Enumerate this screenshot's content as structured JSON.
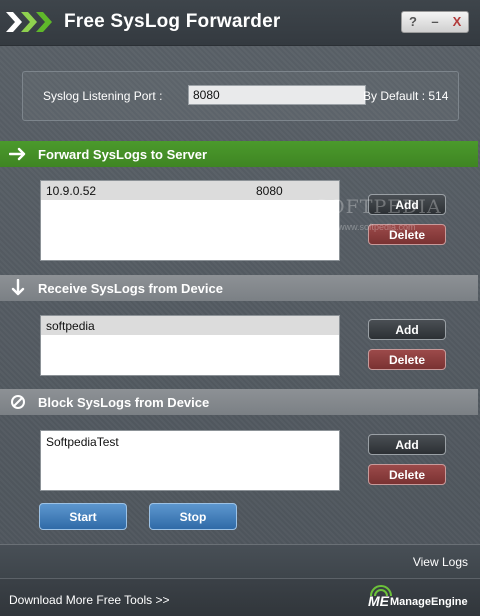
{
  "window": {
    "title": "Free SysLog Forwarder",
    "controls": {
      "help": "?",
      "minimize": "–",
      "close": "X"
    }
  },
  "port": {
    "label": "Syslog Listening Port  :",
    "value": "8080",
    "default_text": "By Default : 514"
  },
  "forward": {
    "title": "Forward SysLogs to Server",
    "rows": [
      {
        "host": "10.9.0.52",
        "port": "8080"
      }
    ],
    "add_label": "Add",
    "delete_label": "Delete"
  },
  "receive": {
    "title": "Receive SysLogs from Device",
    "rows": [
      {
        "host": "softpedia"
      }
    ],
    "add_label": "Add",
    "delete_label": "Delete"
  },
  "block": {
    "title": "Block SysLogs from Device",
    "rows": [
      {
        "host": "SoftpediaTest"
      }
    ],
    "add_label": "Add",
    "delete_label": "Delete"
  },
  "actions": {
    "start_label": "Start",
    "stop_label": "Stop"
  },
  "footer": {
    "view_logs": "View Logs",
    "download_link": "Download More Free Tools >>",
    "brand_mark": "ME",
    "brand_name": "ManageEngine"
  },
  "watermark": {
    "text": "SOFTPEDIA",
    "sub": "www.softpedia.com"
  },
  "colors": {
    "forward_header": "#4b9a2c",
    "section_header": "#8d9195",
    "delete_button": "#9c4a4a",
    "primary_button": "#3f7bb8"
  }
}
